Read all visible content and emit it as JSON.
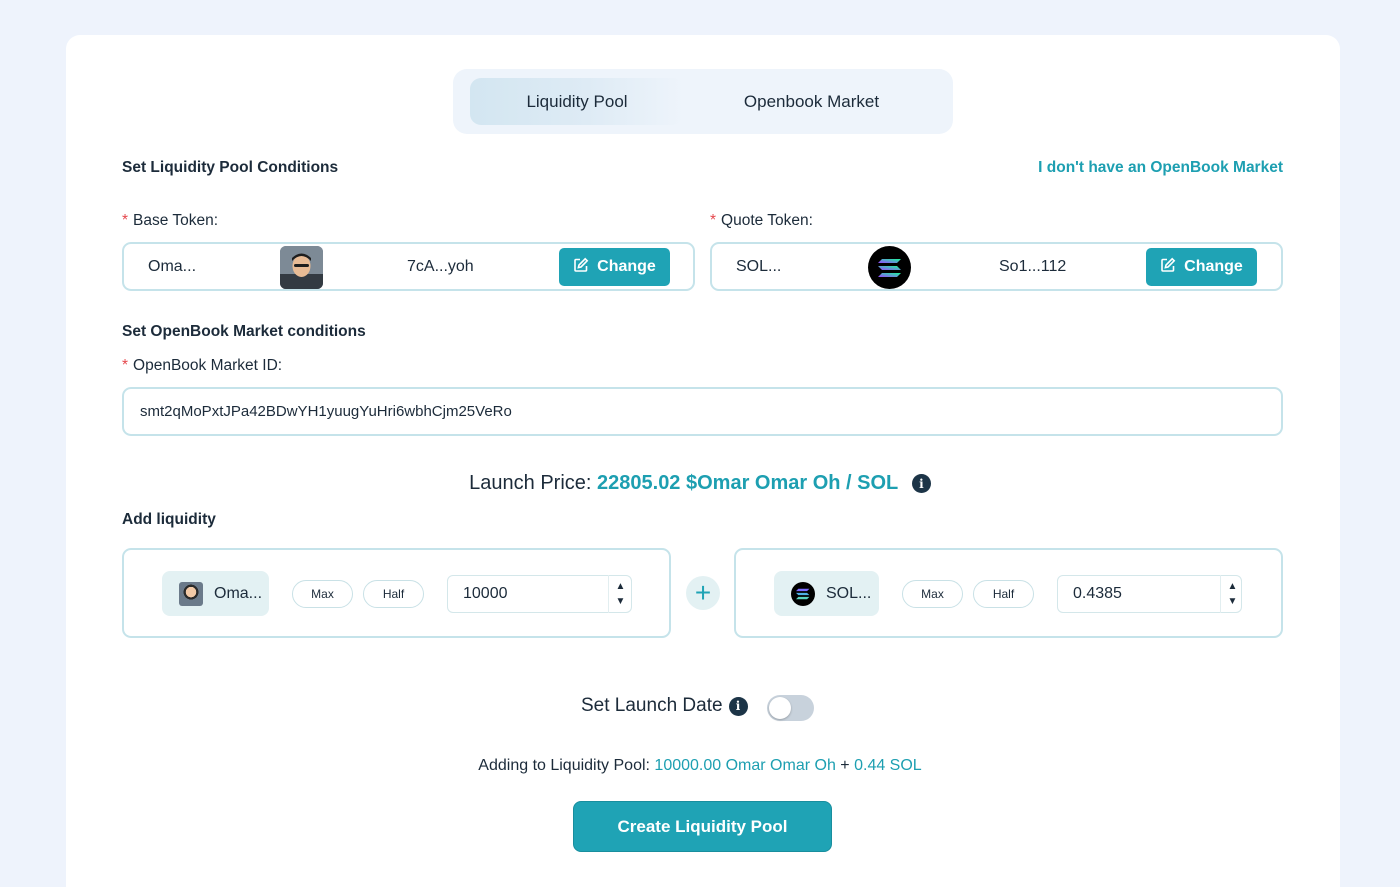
{
  "tabs": [
    {
      "label": "Liquidity Pool",
      "active": true
    },
    {
      "label": "Openbook Market",
      "active": false
    }
  ],
  "pool_conditions": {
    "title": "Set Liquidity Pool Conditions",
    "no_market_link": "I don't have an OpenBook Market"
  },
  "base_token": {
    "required_mark": "*",
    "label": "Base Token:",
    "name": "Oma...",
    "address": "7cA...yoh",
    "change_label": "Change",
    "icon": "user-avatar"
  },
  "quote_token": {
    "required_mark": "*",
    "label": "Quote Token:",
    "name": "SOL...",
    "address": "So1...112",
    "change_label": "Change",
    "icon": "solana-logo"
  },
  "market": {
    "title": "Set OpenBook Market conditions",
    "required_mark": "*",
    "id_label": "OpenBook Market ID:",
    "id_value": "smt2qMoPxtJPa42BDwYH1yuugYuHri6wbhCjm25VeRo"
  },
  "launch_price": {
    "label": "Launch Price:",
    "value": "22805.02 $Omar Omar Oh / SOL"
  },
  "add_liquidity": {
    "title": "Add liquidity",
    "base": {
      "token": "Oma...",
      "max_label": "Max",
      "half_label": "Half",
      "amount": "10000"
    },
    "quote": {
      "token": "SOL...",
      "max_label": "Max",
      "half_label": "Half",
      "amount": "0.4385"
    }
  },
  "launch_date": {
    "label": "Set Launch Date",
    "enabled": false
  },
  "summary": {
    "prefix": "Adding to Liquidity Pool:",
    "base_amount": "10000.00 Omar Omar Oh",
    "plus": "+",
    "quote_amount": "0.44 SOL"
  },
  "create_button": "Create Liquidity Pool",
  "colors": {
    "accent": "#1fa3b5",
    "accent_text": "#1d9fb1",
    "required": "#e5484d",
    "background": "#eef3fc"
  }
}
